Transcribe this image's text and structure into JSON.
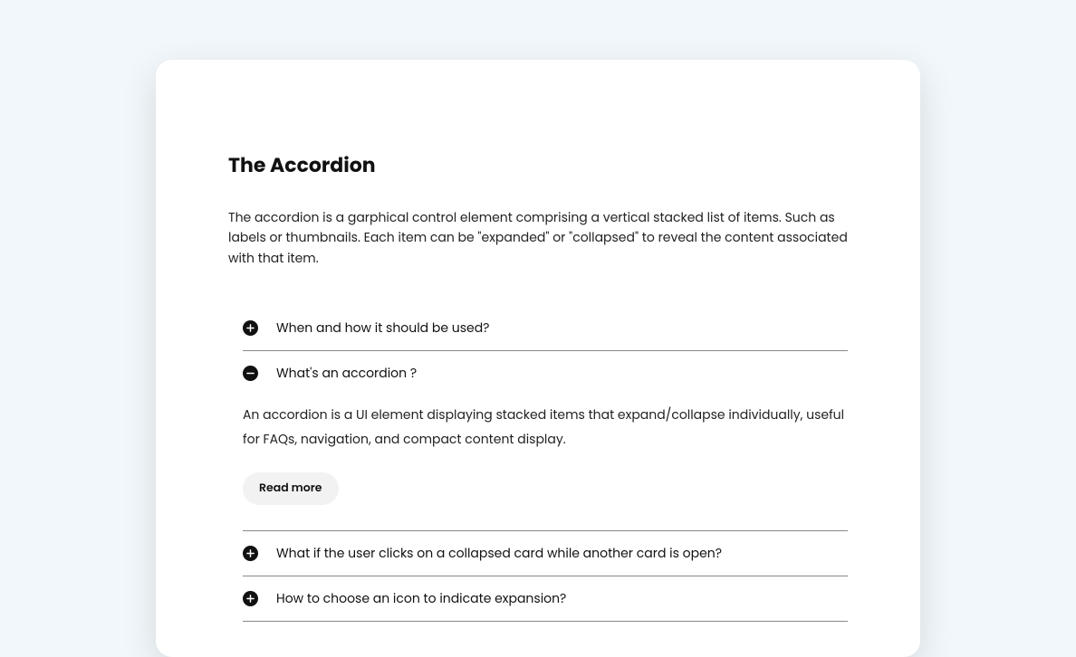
{
  "title": "The Accordion",
  "description": "The accordion is a garphical control element comprising a vertical stacked list of items. Such as labels or thumbnails. Each item can be \"expanded\" or \"collapsed\" to reveal the content associated with that item.",
  "items": [
    {
      "label": "When and how it should be used?",
      "expanded": false
    },
    {
      "label": "What's an accordion ?",
      "expanded": true,
      "body": "An accordion is a UI element displaying stacked items that expand/collapse individually, useful for FAQs, navigation, and compact content display.",
      "cta": "Read more"
    },
    {
      "label": "What if the user clicks on a collapsed card while another card is open?",
      "expanded": false
    },
    {
      "label": "How to choose an icon to indicate expansion?",
      "expanded": false
    }
  ]
}
